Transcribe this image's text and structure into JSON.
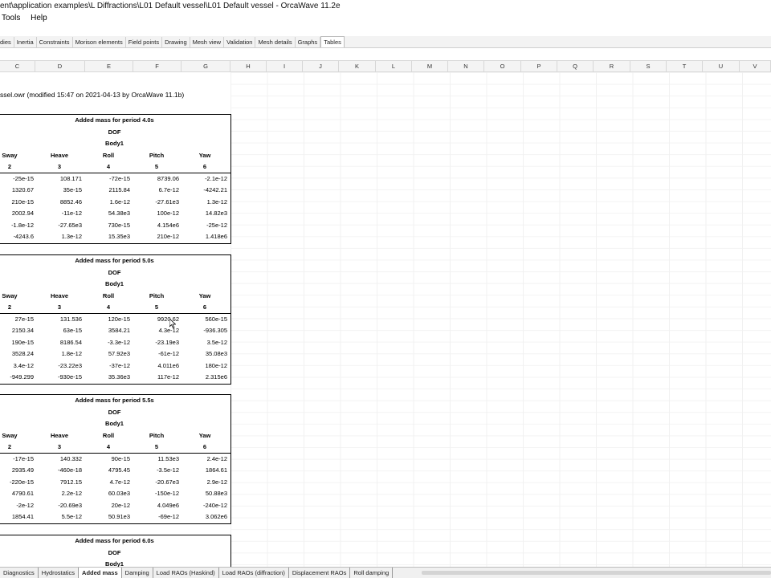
{
  "window": {
    "title": "ent\\application examples\\L Diffractions\\L01 Default vessel\\L01 Default vessel - OrcaWave 11.2e"
  },
  "menu": {
    "items": [
      "Tools",
      "Help"
    ]
  },
  "result_tabs": [
    {
      "label": "dies"
    },
    {
      "label": "Inertia"
    },
    {
      "label": "Constraints"
    },
    {
      "label": "Morison elements"
    },
    {
      "label": "Field points"
    },
    {
      "label": "Drawing"
    },
    {
      "label": "Mesh view"
    },
    {
      "label": "Validation"
    },
    {
      "label": "Mesh details"
    },
    {
      "label": "Graphs"
    },
    {
      "label": "Tables"
    }
  ],
  "active_result_tab": "Tables",
  "columns": [
    "C",
    "D",
    "E",
    "F",
    "G",
    "H",
    "I",
    "J",
    "K",
    "L",
    "M",
    "N",
    "O",
    "P",
    "Q",
    "R",
    "S",
    "T",
    "U",
    "V"
  ],
  "file_info": "ssel.owr (modified 15:47 on 2021-04-13 by OrcaWave 11.1b)",
  "tables": [
    {
      "title": "Added mass for period 4.0s",
      "dof_label": "DOF",
      "body_label": "Body1",
      "headers": [
        "Sway",
        "Heave",
        "Roll",
        "Pitch",
        "Yaw"
      ],
      "indices": [
        "2",
        "3",
        "4",
        "5",
        "6"
      ],
      "rows": [
        [
          "-25e-15",
          "108.171",
          "-72e-15",
          "8739.06",
          "-2.1e-12"
        ],
        [
          "1320.67",
          "35e-15",
          "2115.84",
          "6.7e-12",
          "-4242.21"
        ],
        [
          "210e-15",
          "8852.46",
          "1.6e-12",
          "-27.61e3",
          "1.3e-12"
        ],
        [
          "2002.94",
          "-11e-12",
          "54.38e3",
          "100e-12",
          "14.82e3"
        ],
        [
          "-1.8e-12",
          "-27.65e3",
          "730e-15",
          "4.154e6",
          "-25e-12"
        ],
        [
          "-4243.6",
          "1.3e-12",
          "15.35e3",
          "210e-12",
          "1.418e6"
        ]
      ]
    },
    {
      "title": "Added mass for period 5.0s",
      "dof_label": "DOF",
      "body_label": "Body1",
      "headers": [
        "Sway",
        "Heave",
        "Roll",
        "Pitch",
        "Yaw"
      ],
      "indices": [
        "2",
        "3",
        "4",
        "5",
        "6"
      ],
      "rows": [
        [
          "27e-15",
          "131.536",
          "120e-15",
          "9920.62",
          "560e-15"
        ],
        [
          "2150.34",
          "63e-15",
          "3584.21",
          "4.3e-12",
          "-936.305"
        ],
        [
          "190e-15",
          "8186.54",
          "-3.3e-12",
          "-23.19e3",
          "3.5e-12"
        ],
        [
          "3528.24",
          "1.8e-12",
          "57.92e3",
          "-61e-12",
          "35.08e3"
        ],
        [
          "3.4e-12",
          "-23.22e3",
          "-37e-12",
          "4.011e6",
          "180e-12"
        ],
        [
          "-949.299",
          "-930e-15",
          "35.36e3",
          "117e-12",
          "2.315e6"
        ]
      ]
    },
    {
      "title": "Added mass for period 5.5s",
      "dof_label": "DOF",
      "body_label": "Body1",
      "headers": [
        "Sway",
        "Heave",
        "Roll",
        "Pitch",
        "Yaw"
      ],
      "indices": [
        "2",
        "3",
        "4",
        "5",
        "6"
      ],
      "rows": [
        [
          "-17e-15",
          "140.332",
          "90e-15",
          "11.53e3",
          "2.4e-12"
        ],
        [
          "2935.49",
          "-460e-18",
          "4795.45",
          "-3.5e-12",
          "1864.61"
        ],
        [
          "-220e-15",
          "7912.15",
          "4.7e-12",
          "-20.67e3",
          "2.9e-12"
        ],
        [
          "4790.61",
          "2.2e-12",
          "60.03e3",
          "-150e-12",
          "50.88e3"
        ],
        [
          "-2e-12",
          "-20.69e3",
          "20e-12",
          "4.049e6",
          "-240e-12"
        ],
        [
          "1854.41",
          "5.5e-12",
          "50.91e3",
          "-69e-12",
          "3.062e6"
        ]
      ]
    },
    {
      "title": "Added mass for period 6.0s",
      "dof_label": "DOF",
      "body_label": "Body1"
    }
  ],
  "sheet_tabs": [
    {
      "label": "Diagnostics"
    },
    {
      "label": "Hydrostatics"
    },
    {
      "label": "Added mass"
    },
    {
      "label": "Damping"
    },
    {
      "label": "Load RAOs (Haskind)"
    },
    {
      "label": "Load RAOs (diffraction)"
    },
    {
      "label": "Displacement RAOs"
    },
    {
      "label": "Roll damping"
    }
  ],
  "active_sheet_tab": "Added mass",
  "icons": {
    "cursor": "mouse-pointer-icon"
  }
}
